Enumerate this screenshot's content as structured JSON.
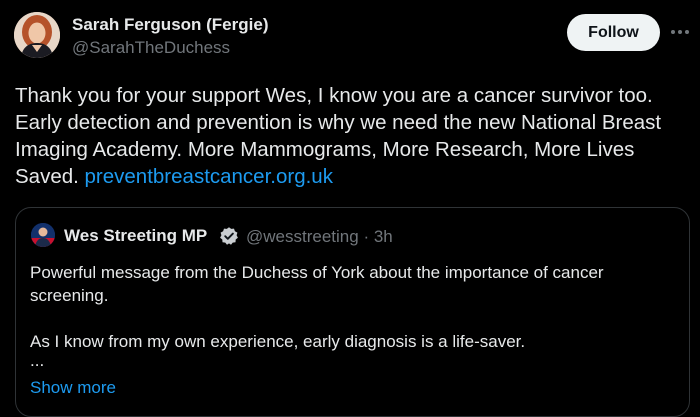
{
  "tweet": {
    "author_name": "Sarah Ferguson (Fergie)",
    "author_handle": "@SarahTheDuchess",
    "follow_label": "Follow",
    "more_icon": "more-horizontal-icon",
    "text": "Thank you for your support Wes, I know you are a cancer survivor too. Early detection and prevention is why we need the new National Breast Imaging Academy. More Mammograms, More Research, More Lives Saved.",
    "link": "preventbreastcancer.org.uk"
  },
  "quote": {
    "author_name": "Wes Streeting MP",
    "verified_icon": "verified-badge-icon",
    "handle": "@wesstreeting",
    "separator": "·",
    "time": "3h",
    "paragraph1": "Powerful message from the Duchess of York about the importance of cancer screening.",
    "paragraph2": "As I know from my own experience, early diagnosis is a life-saver.",
    "ellipsis": "...",
    "show_more": "Show more"
  },
  "colors": {
    "background": "#000000",
    "text_primary": "#e7e9ea",
    "text_secondary": "#71767b",
    "link": "#1d9bf0",
    "border": "#2f3336",
    "follow_bg": "#eff3f4",
    "verified_blue": "#1d9bf0"
  }
}
